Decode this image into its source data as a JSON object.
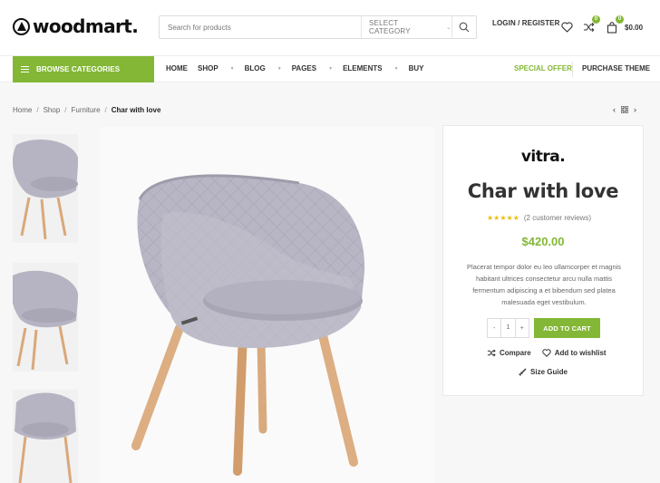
{
  "header": {
    "logo_text": "woodmart.",
    "search_placeholder": "Search for products",
    "search_category": "SELECT CATEGORY",
    "login_label": "LOGIN / REGISTER",
    "compare_count": "0",
    "cart_count": "0",
    "cart_total": "$0.00"
  },
  "nav": {
    "browse_label": "BROWSE CATEGORIES",
    "menu": [
      "HOME",
      "SHOP",
      "BLOG",
      "PAGES",
      "ELEMENTS",
      "BUY"
    ],
    "special_offer": "SPECIAL OFFER",
    "purchase_theme": "PURCHASE THEME"
  },
  "breadcrumb": {
    "items": [
      "Home",
      "Shop",
      "Furniture"
    ],
    "current": "Char with love",
    "separator": "/"
  },
  "product": {
    "brand": "vitra.",
    "title": "Char with love",
    "stars": "★★★★★",
    "reviews": "(2 customer reviews)",
    "price": "$420.00",
    "description": "Placerat tempor dolor eu leo ullamcorper et magnis habitant ultrices consectetur arcu nulla mattis fermentum adipiscing a et bibendum sed platea malesuada eget vestibulum.",
    "qty_minus": "-",
    "qty_value": "1",
    "qty_plus": "+",
    "add_to_cart": "ADD TO CART",
    "compare": "Compare",
    "wishlist": "Add to wishlist",
    "size_guide": "Size Guide"
  },
  "colors": {
    "accent": "#83b735",
    "star": "#eabe12",
    "fabric": "#b6b4c2",
    "wood": "#d9a87a"
  }
}
